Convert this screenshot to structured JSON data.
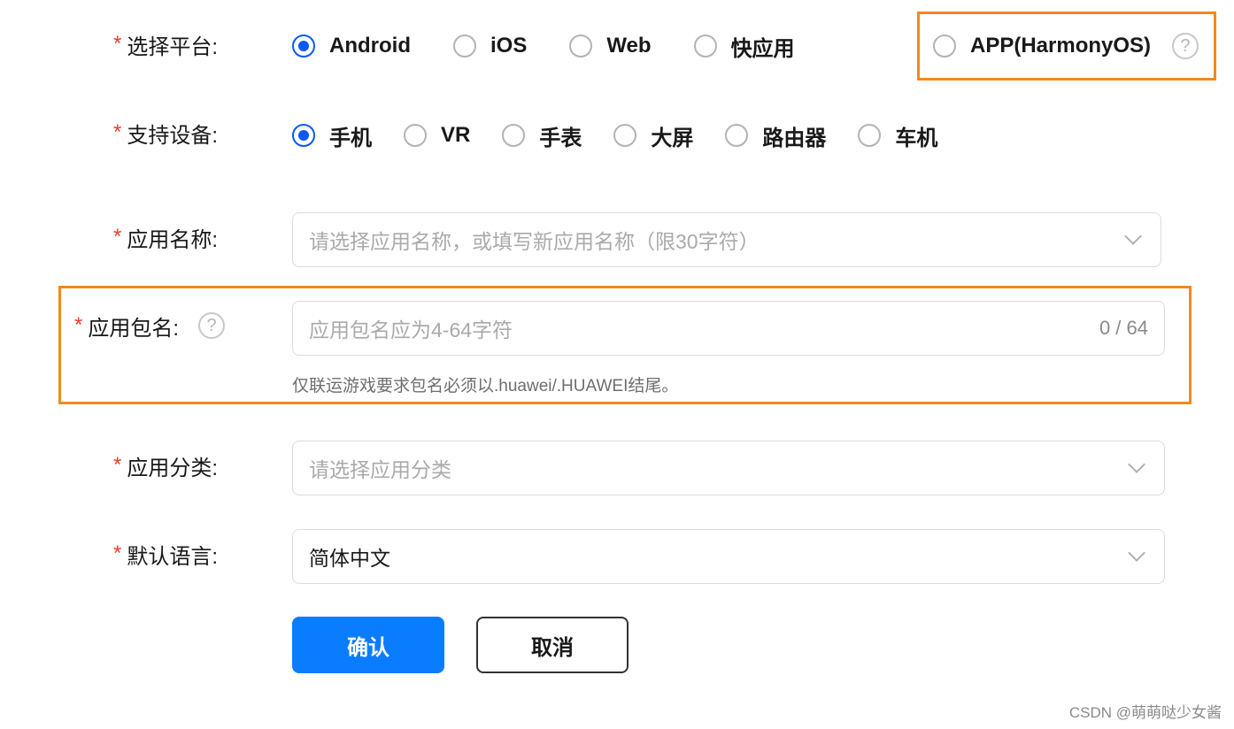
{
  "platform": {
    "label": "选择平台:",
    "options": [
      "Android",
      "iOS",
      "Web",
      "快应用",
      "APP(HarmonyOS)"
    ],
    "selected": "Android"
  },
  "devices": {
    "label": "支持设备:",
    "options": [
      "手机",
      "VR",
      "手表",
      "大屏",
      "路由器",
      "车机"
    ],
    "selected": "手机"
  },
  "app_name": {
    "label": "应用名称:",
    "placeholder": "请选择应用名称，或填写新应用名称（限30字符）"
  },
  "package_name": {
    "label": "应用包名:",
    "placeholder": "应用包名应为4-64字符",
    "counter": "0 / 64",
    "hint": "仅联运游戏要求包名必须以.huawei/.HUAWEI结尾。"
  },
  "category": {
    "label": "应用分类:",
    "placeholder": "请选择应用分类"
  },
  "language": {
    "label": "默认语言:",
    "value": "简体中文"
  },
  "required_mark": "*",
  "buttons": {
    "confirm": "确认",
    "cancel": "取消"
  },
  "watermark": "CSDN @萌萌哒少女酱",
  "icons": {
    "help": "?"
  },
  "colors": {
    "accent": "#0a59f7",
    "primary_button": "#0a7cff",
    "highlight": "#f08a1e",
    "required": "#e84026"
  }
}
